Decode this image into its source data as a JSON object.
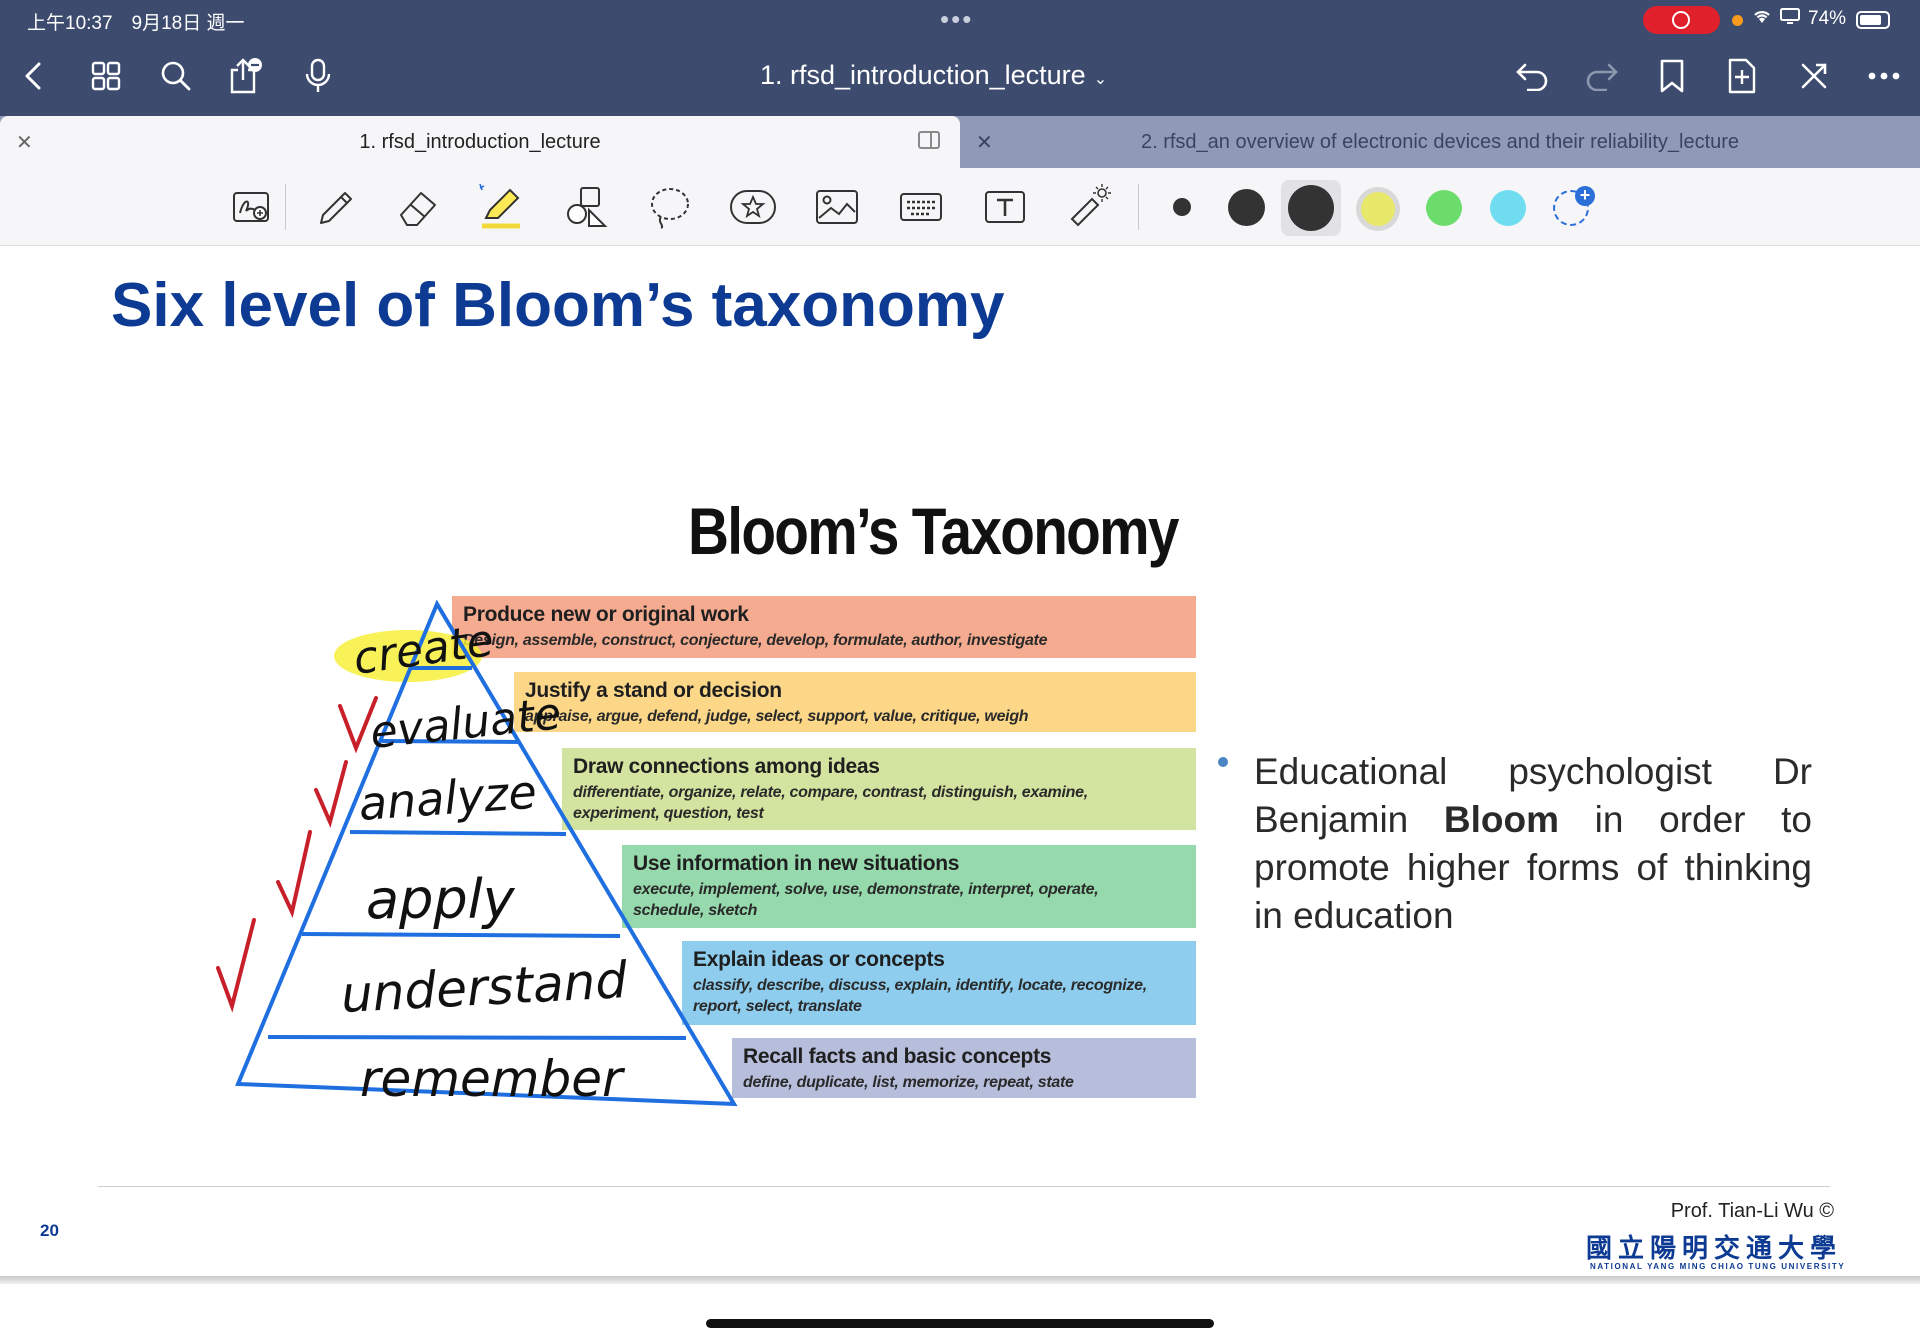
{
  "status_bar": {
    "time": "上午10:37　9月18日 週一",
    "dots": "•••",
    "battery": "74%"
  },
  "nav": {
    "title": "1. rfsd_introduction_lecture",
    "icons": [
      "back-chevron-icon",
      "grid-icon",
      "search-icon",
      "share-icon",
      "microphone-icon",
      "undo-icon",
      "redo-icon",
      "bookmark-icon",
      "add-page-icon",
      "close-toolbar-icon",
      "more-icon"
    ]
  },
  "tabs": [
    {
      "label": "1. rfsd_introduction_lecture",
      "active": true
    },
    {
      "label": "2. rfsd_an overview of electronic devices and their reliability_lecture",
      "active": false
    }
  ],
  "toolbar": {
    "tools": [
      "lasso-zoom-icon",
      "pen-icon",
      "eraser-icon",
      "highlighter-icon",
      "shapes-icon",
      "lasso-icon",
      "sticker-icon",
      "image-icon",
      "keyboard-icon",
      "textbox-icon",
      "laser-pointer-icon"
    ],
    "colors": [
      "#333333",
      "#333333",
      "#333333",
      "#e8e86a",
      "#6cdc6c",
      "#6fdcf0"
    ]
  },
  "slide": {
    "title": "Six level of Bloom’s taxonomy",
    "figure_title": "Bloom’s Taxonomy",
    "levels": [
      {
        "heading": "Produce new or original work",
        "verbs": "Design, assemble, construct, conjecture, develop, formulate, author, investigate",
        "color": "#f5ab90"
      },
      {
        "heading": "Justify a stand or decision",
        "verbs": "appraise, argue, defend, judge, select, support, value, critique, weigh",
        "color": "#fcd788"
      },
      {
        "heading": "Draw connections among ideas",
        "verbs": "differentiate, organize, relate, compare, contrast, distinguish, examine, experiment, question, test",
        "color": "#d3e4a0"
      },
      {
        "heading": "Use information in new situations",
        "verbs": "execute, implement, solve, use, demonstrate, interpret, operate, schedule, sketch",
        "color": "#96d9ac"
      },
      {
        "heading": "Explain ideas or concepts",
        "verbs": "classify, describe, discuss, explain, identify, locate, recognize, report, select, translate",
        "color": "#8ecdee"
      },
      {
        "heading": "Recall facts and basic concepts",
        "verbs": "define, duplicate, list, memorize, repeat, state",
        "color": "#b7bedb"
      }
    ],
    "handwritten": [
      "create",
      "evaluate",
      "analyze",
      "apply",
      "understand",
      "remember"
    ],
    "bullet": {
      "before": "Educational psychologist Dr Benjamin ",
      "bold": "Bloom",
      "after": " in order to promote higher forms of thinking in education"
    },
    "page_number": "20",
    "author": "Prof. Tian-Li Wu ©",
    "university_cn": "國立陽明交通大學",
    "university_en": "NATIONAL YANG MING CHIAO TUNG UNIVERSITY"
  }
}
